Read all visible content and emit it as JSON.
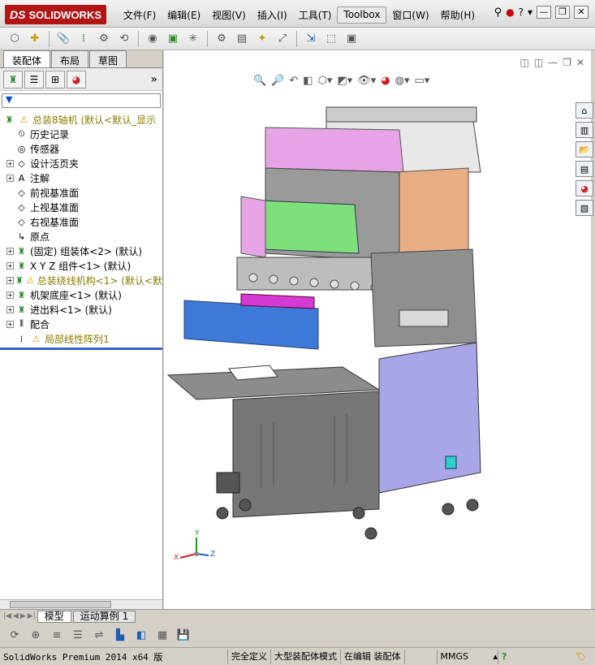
{
  "app": {
    "brand": "SOLIDWORKS",
    "brand_prefix": "DS"
  },
  "menu": [
    "文件(F)",
    "编辑(E)",
    "视图(V)",
    "插入(I)",
    "工具(T)",
    "Toolbox",
    "窗口(W)",
    "帮助(H)"
  ],
  "left_tabs": [
    "装配体",
    "布局",
    "草图"
  ],
  "tree": {
    "root": "总装8轴机  (默认<默认_显示",
    "items": [
      {
        "label": "历史记录",
        "icon": "history-icon",
        "expandable": false
      },
      {
        "label": "传感器",
        "icon": "sensor-icon",
        "expandable": false
      },
      {
        "label": "设计活页夹",
        "icon": "binder-icon",
        "expandable": true
      },
      {
        "label": "注解",
        "icon": "annotation-icon",
        "expandable": true
      },
      {
        "label": "前视基准面",
        "icon": "plane-icon",
        "expandable": false
      },
      {
        "label": "上视基准面",
        "icon": "plane-icon",
        "expandable": false
      },
      {
        "label": "右视基准面",
        "icon": "plane-icon",
        "expandable": false
      },
      {
        "label": "原点",
        "icon": "origin-icon",
        "expandable": false
      },
      {
        "label": "(固定) 组装体<2> (默认)",
        "icon": "assembly-icon",
        "expandable": true,
        "warn": false
      },
      {
        "label": "X Y Z 组件<1> (默认)",
        "icon": "assembly-icon",
        "expandable": true,
        "warn": false
      },
      {
        "label": "总装绕线机构<1> (默认<默",
        "icon": "assembly-icon",
        "expandable": true,
        "warn": true
      },
      {
        "label": "机架底座<1> (默认)",
        "icon": "assembly-icon",
        "expandable": true,
        "warn": false
      },
      {
        "label": "进出料<1> (默认)",
        "icon": "assembly-icon",
        "expandable": true,
        "warn": false
      },
      {
        "label": "配合",
        "icon": "mates-icon",
        "expandable": true,
        "warn": false
      },
      {
        "label": "局部线性阵列1",
        "icon": "pattern-icon",
        "expandable": false,
        "warn": true
      }
    ]
  },
  "bottom_tabs": [
    "模型",
    "运动算例 1"
  ],
  "status": {
    "app_version": "SolidWorks Premium 2014 x64 版",
    "definition": "完全定义",
    "mode": "大型装配体模式",
    "editing": "在编辑 装配体",
    "units": "MMGS"
  },
  "triad": {
    "x": "X",
    "y": "Y",
    "z": "Z"
  },
  "colors": {
    "brand_red": "#b11515",
    "warn": "#c89a00"
  }
}
